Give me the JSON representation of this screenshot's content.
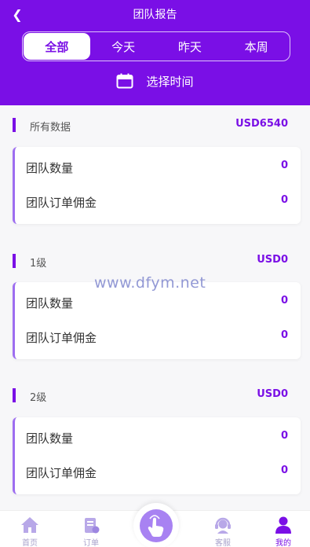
{
  "header": {
    "title": "团队报告",
    "tabs": [
      "全部",
      "今天",
      "昨天",
      "本周"
    ],
    "active_tab": 0,
    "time_picker_label": "选择时间"
  },
  "sections": [
    {
      "name": "所有数据",
      "amount": "USD6540",
      "rows": [
        {
          "label": "团队数量",
          "value": "0"
        },
        {
          "label": "团队订单佣金",
          "value": "0"
        }
      ]
    },
    {
      "name": "1级",
      "amount": "USD0",
      "rows": [
        {
          "label": "团队数量",
          "value": "0"
        },
        {
          "label": "团队订单佣金",
          "value": "0"
        }
      ]
    },
    {
      "name": "2级",
      "amount": "USD0",
      "rows": [
        {
          "label": "团队数量",
          "value": "0"
        },
        {
          "label": "团队订单佣金",
          "value": "0"
        }
      ]
    }
  ],
  "watermark": "www.dfym.net",
  "tabbar": {
    "items": [
      {
        "label": "首页",
        "icon": "home-icon"
      },
      {
        "label": "订单",
        "icon": "order-icon"
      },
      {
        "label": "",
        "icon": "tap-hand-icon"
      },
      {
        "label": "客服",
        "icon": "customer-service-icon"
      },
      {
        "label": "我的",
        "icon": "user-icon"
      }
    ],
    "active_index": 4
  },
  "colors": {
    "primary": "#7a0fe6",
    "card_accent": "#9d6df0",
    "tab_inactive": "#a9a3cc"
  }
}
